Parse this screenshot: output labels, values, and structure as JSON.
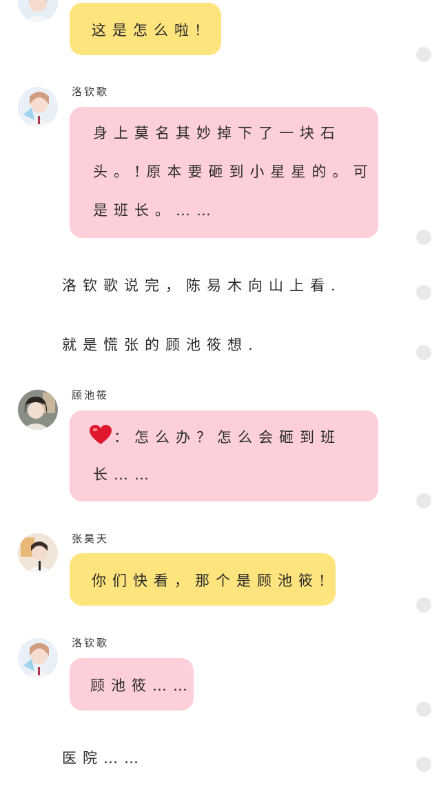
{
  "messages": [
    {
      "text": "这是怎么啦!"
    },
    {
      "sender": "洛钦歌",
      "lines": [
        "身上莫名其妙掉下了一块石",
        "头。!原本要砸到小星星的。可",
        "是班长。……"
      ]
    },
    {
      "sender": "顾池筱",
      "line1": "：怎么办？怎么会砸到班",
      "line2": "长……"
    },
    {
      "sender": "张昊天",
      "text": "你们快看，那个是顾池筱!"
    },
    {
      "sender": "洛钦歌",
      "text": "顾池筱……"
    }
  ],
  "narration": [
    "洛钦歌说完，陈易木向山上看.",
    "就是慌张的顾池筱想.",
    "医院……"
  ],
  "icons": {
    "avatar_luo": "avatar-girl-selfie",
    "avatar_gu": "avatar-girl-dark-hair",
    "avatar_zhang": "avatar-boy",
    "heart": "red-heart-emoji",
    "dot": "gray-dot"
  },
  "colors": {
    "pink_bubble": "#fdd0d9",
    "yellow_bubble": "#fee47c",
    "dot": "#e9e9e9"
  }
}
